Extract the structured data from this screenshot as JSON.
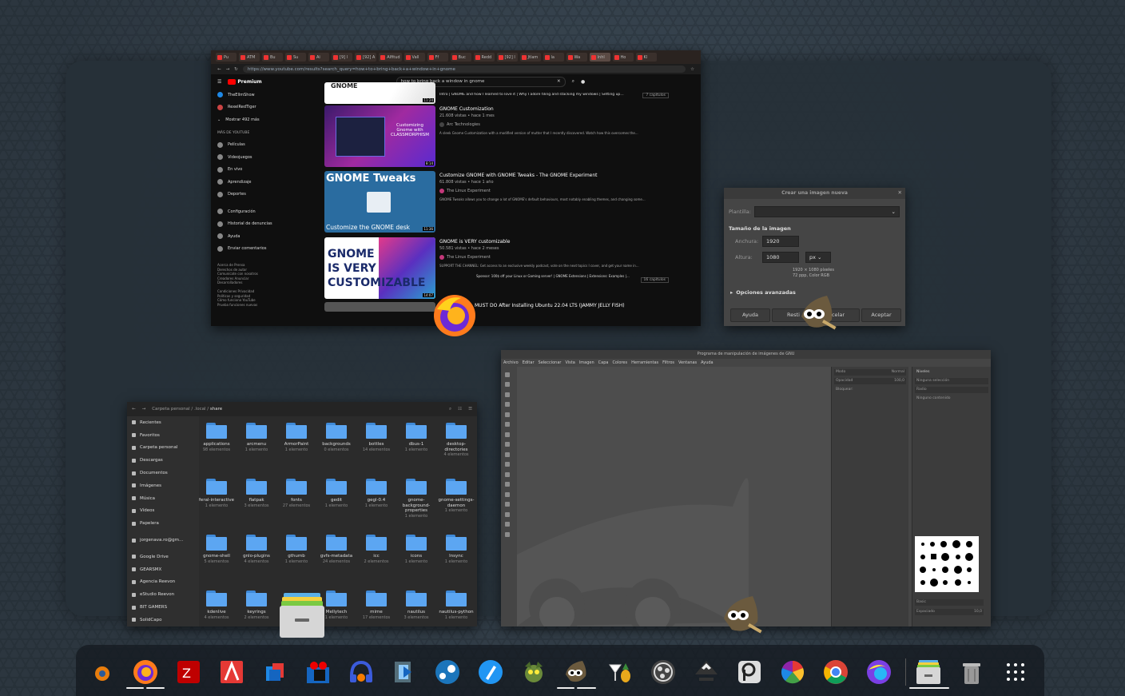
{
  "browser": {
    "tabs": [
      "Pu",
      "ATM",
      "Bu",
      "Su",
      "Ai",
      "[9] l",
      "[92] A",
      "Alfitud",
      "Vall",
      "Ff",
      "Buc",
      "Redd",
      "[92] l",
      "Jtlam",
      "la",
      "Wa",
      "Inhl",
      "Ho",
      "Kl"
    ],
    "url": "https://www.youtube.com/results?search_query=how+to+bring+back+a+window+in+gnome",
    "logo": "Premium",
    "search_value": "how to bring back a window in gnome",
    "sidebar": {
      "top_items": [
        "TheEllmShow",
        "RexelRedTiger",
        "Mostrar 492 más"
      ],
      "section_title": "MÁS DE YOUTUBE",
      "items": [
        "Películas",
        "Videojuegos",
        "En vivo",
        "Aprendizaje",
        "Deportes"
      ],
      "items2": [
        "Configuración",
        "Historial de denuncias",
        "Ayuda",
        "Enviar comentarios"
      ],
      "footer": "Acerca de   Prensa\nDerechos de autor\nComunícate con nosotros\nCreadores   Anunciar\nDesarrolladores\n\nCondiciones   Privacidad\nPolíticas y seguridad\nCómo funciona YouTube\nPrueba funciones nuevas"
    },
    "videos": [
      {
        "title": "Intro | GNOME and how I learned to love it | Why I adore tiling and stacking my windows | Setting up…",
        "meta": "",
        "channel": "",
        "desc": "",
        "chapters": "7 capítulos",
        "thumb_text": "GNOME",
        "duration": "11:24"
      },
      {
        "title": "GNOME Customization",
        "meta": "21.608 vistas • hace 1 mes",
        "channel": "Arc Technologies",
        "desc": "A sleek Gnome Customization with a modified version of mutter that I recently discovered. Watch how this overcomes the...",
        "chapters": "",
        "thumb_text": "Customizing Gnome with CLASSMORPHISM",
        "duration": "8:14"
      },
      {
        "title": "Customize GNOME with GNOME Tweaks - The GNOME Experiment",
        "meta": "61.808 vistas • hace 1 año",
        "channel": "The Linux Experiment",
        "desc": "GNOME Tweaks allows you to change a lot of GNOME's default behaviours, most notably enabling themes, and changing some...",
        "chapters": "",
        "thumb_text": "GNOME Tweaks",
        "thumb_sub": "Customize the GNOME desk",
        "duration": "11:36"
      },
      {
        "title": "GNOME is VERY customizable",
        "meta": "50.581 vistas • hace 2 meses",
        "channel": "The Linux Experiment",
        "desc": "SUPPORT THE CHANNEL: Get access to an exclusive weekly podcast, vote on the next topics I cover, and get your name in...",
        "chapters": "16 capítulos",
        "sponsor": "Sponsor: 100$ off your Linux or Gaming server! | GNOME Extensions | Extensions: Examples |...",
        "thumb_text": "GNOME IS VERY CUSTOMIZABLE",
        "duration": "14:07"
      },
      {
        "title": "MUST DO After Installing Ubuntu 22.04 LTS (JAMMY JELLY FISH)",
        "meta": "",
        "channel": "",
        "desc": "",
        "chapters": "",
        "thumb_text": "",
        "duration": ""
      }
    ]
  },
  "dialog": {
    "title": "Crear una imagen nueva",
    "plantilla_label": "Plantilla:",
    "size_section": "Tamaño de la imagen",
    "width_label": "Anchura:",
    "width_value": "1920",
    "height_label": "Altura:",
    "height_value": "1080",
    "unit": "px",
    "info1": "1920 × 1080 píxeles",
    "info2": "72 ppp, Color RGB",
    "advanced": "Opciones avanzadas",
    "buttons": [
      "Ayuda",
      "Restablecer",
      "Cancelar",
      "Aceptar"
    ],
    "buttons_visible": [
      "Ayuda",
      "Resti",
      "celar",
      "Aceptar"
    ]
  },
  "gimp": {
    "title": "Programa de manipulación de imágenes de GNU",
    "menu": [
      "Archivo",
      "Editar",
      "Seleccionar",
      "Vista",
      "Imagen",
      "Capa",
      "Colores",
      "Herramientas",
      "Filtros",
      "Ventanas",
      "Ayuda"
    ],
    "dock1": [
      "Modo",
      "Normal",
      "Opacidad",
      "100,0",
      "Bloquear:"
    ],
    "dock2": [
      "Niveles",
      "Modo",
      "Radio",
      "Ninguna selección",
      "Ninguno contenido",
      "Brush",
      "Basic",
      "Espaciado",
      "10,0"
    ]
  },
  "files": {
    "path": [
      "Carpeta personal",
      ".local",
      "share"
    ],
    "sidebar": [
      "Recientes",
      "Favoritos",
      "Carpeta personal",
      "Descargas",
      "Documentos",
      "Imágenes",
      "Música",
      "Vídeos",
      "Papelera",
      "jorgenava.ro@gm...",
      "Google Drive",
      "GEARSMX",
      "Agencia Reevon",
      "eStudio Reevon",
      "BIT GAMERS",
      "SolidCapo"
    ],
    "folders": [
      {
        "name": "applications",
        "count": "98 elementos"
      },
      {
        "name": "arcmenu",
        "count": "1 elemento"
      },
      {
        "name": "ArmorPaint",
        "count": "1 elemento"
      },
      {
        "name": "backgrounds",
        "count": "0 elementos"
      },
      {
        "name": "bottles",
        "count": "14 elementos"
      },
      {
        "name": "dbus-1",
        "count": "1 elemento"
      },
      {
        "name": "desktop-directories",
        "count": "4 elementos"
      },
      {
        "name": "feral-interactive",
        "count": "1 elemento"
      },
      {
        "name": "flatpak",
        "count": "3 elementos"
      },
      {
        "name": "fonts",
        "count": "27 elementos"
      },
      {
        "name": "gedit",
        "count": "1 elemento"
      },
      {
        "name": "gegl-0.4",
        "count": "1 elemento"
      },
      {
        "name": "gnome-background-properties",
        "count": "1 elemento"
      },
      {
        "name": "gnome-settings-daemon",
        "count": "1 elemento"
      },
      {
        "name": "gnome-shell",
        "count": "5 elementos"
      },
      {
        "name": "gnlo-plugins",
        "count": "4 elementos"
      },
      {
        "name": "gthumb",
        "count": "1 elemento"
      },
      {
        "name": "gvfs-metadata",
        "count": "24 elementos"
      },
      {
        "name": "icc",
        "count": "2 elementos"
      },
      {
        "name": "icons",
        "count": "1 elemento"
      },
      {
        "name": "lnsync",
        "count": "1 elemento"
      },
      {
        "name": "kdenlive",
        "count": "4 elementos"
      },
      {
        "name": "keyrings",
        "count": "2 elementos"
      },
      {
        "name": "",
        "count": ""
      },
      {
        "name": "Mellytech",
        "count": "1 elemento"
      },
      {
        "name": "mime",
        "count": "17 elementos"
      },
      {
        "name": "nautilus",
        "count": "3 elementos"
      },
      {
        "name": "nautilus-python",
        "count": "1 elemento"
      }
    ]
  },
  "dock": {
    "apps": [
      "blender-icon",
      "firefox-icon",
      "filezilla-icon",
      "anydesk-icon",
      "stack-icon",
      "video-icon",
      "headphones-icon",
      "film-icon",
      "steam-icon",
      "pen-icon",
      "gnome-icon",
      "gimp-icon",
      "cocktail-icon",
      "obs-icon",
      "inkscape-icon",
      "parsec-icon",
      "pinwheel-icon",
      "chrome-icon",
      "browser-icon",
      "files-icon",
      "trash-icon",
      "app-grid-icon"
    ]
  }
}
